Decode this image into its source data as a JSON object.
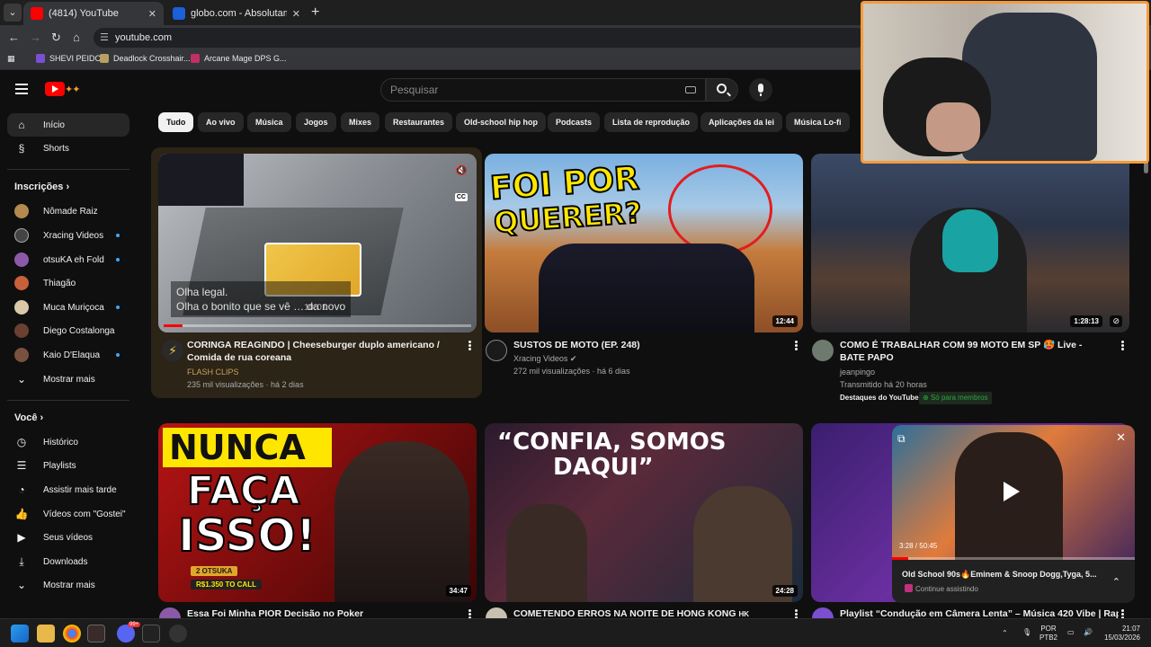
{
  "browser": {
    "tabs": [
      {
        "title": "(4814) YouTube",
        "active": true
      },
      {
        "title": "globo.com - Absolutamente tu",
        "active": false
      }
    ],
    "new_tab": "+",
    "url": "youtube.com",
    "bookmarks": [
      "SHEVI PEIDO",
      "Deadlock Crosshair...",
      "Arcane Mage DPS G..."
    ]
  },
  "youtube": {
    "search_placeholder": "Pesquisar",
    "sidebar": {
      "main": [
        {
          "label": "Início",
          "icon": "home-icon",
          "active": true
        },
        {
          "label": "Shorts",
          "icon": "shorts-icon",
          "active": false
        }
      ],
      "subscriptions_header": "Inscrições",
      "subscriptions": [
        {
          "label": "Nômade Raiz",
          "color": "#b58a4f",
          "dot": false
        },
        {
          "label": "Xracing Videos",
          "color": "#444444",
          "dot": true
        },
        {
          "label": "otsuKA eh Fold",
          "color": "#8a5aa8",
          "dot": true
        },
        {
          "label": "Thiagão",
          "color": "#c8603a",
          "dot": false
        },
        {
          "label": "Muca Muriçoca",
          "color": "#d9c9a8",
          "dot": true
        },
        {
          "label": "Diego Costalonga",
          "color": "#6a4030",
          "dot": false
        },
        {
          "label": "Kaio D'Elaqua",
          "color": "#7a5040",
          "dot": true
        }
      ],
      "show_more": "Mostrar mais",
      "you_header": "Você",
      "you": [
        {
          "label": "Histórico",
          "icon": "history-icon"
        },
        {
          "label": "Playlists",
          "icon": "playlists-icon"
        },
        {
          "label": "Assistir mais tarde",
          "icon": "watch-later-icon"
        },
        {
          "label": "Vídeos com \"Gostei\"",
          "icon": "like-icon"
        },
        {
          "label": "Seus vídeos",
          "icon": "your-videos-icon"
        },
        {
          "label": "Downloads",
          "icon": "downloads-icon"
        }
      ],
      "show_more_2": "Mostrar mais"
    },
    "chips": [
      "Tudo",
      "Ao vivo",
      "Música",
      "Jogos",
      "Mixes",
      "Restaurantes",
      "Old-school hip hop",
      "Podcasts",
      "Lista de reprodução",
      "Aplicações da lei",
      "Música Lo-fi"
    ],
    "videos": [
      {
        "title": "CORINGA REAGINDO | Cheeseburger duplo americano / Comida de rua coreana",
        "channel": "FLASH CLIPS",
        "meta": "235 mil visualizações · há 2 dias",
        "preview_caption_1": "Olha legal.",
        "preview_caption_2": "Olha o bonito que se vê … da novo",
        "preview_time": "10:01",
        "cc": "CC",
        "progress": 0.06
      },
      {
        "title": "SUSTOS DE MOTO (EP. 248)",
        "channel": "Xracing Videos",
        "meta": "272 mil visualizações · há 6 dias",
        "duration": "12:44",
        "thumb_text_1": "FOI POR",
        "thumb_text_2": "QUERER?"
      },
      {
        "title": "COMO É TRABALHAR COM 99 MOTO EM SP 🥵 Live - BATE PAPO",
        "channel": "jeanpingo",
        "meta": "Transmitido há 20 horas",
        "badge_1": "Destaques do YouTube",
        "badge_2": "Só para membros",
        "duration": "1:28:13"
      },
      {
        "title": "Essa Foi Minha PIOR Decisão no Poker",
        "duration": "34:47",
        "thumb_text_1": "NUNCA",
        "thumb_text_2": "FAÇA",
        "thumb_text_3": "ISSO!",
        "thumb_badge_1": "2 OTSUKA",
        "thumb_badge_2": "R$1.350 TO CALL"
      },
      {
        "title": "COMETENDO ERROS NA NOITE DE HONG KONG",
        "title_suffix": "HK",
        "duration": "24:28",
        "thumb_text_1": "“CONFIA, SOMOS",
        "thumb_text_2": "DAQUI”"
      },
      {
        "title": "Playlist “Condução em Câmera Lenta” – Música 420 Vibe | Rap"
      }
    ],
    "miniplayer": {
      "time": "3:28 / 50:45",
      "title": "Old School 90s🔥Eminem & Snoop Dogg,Tyga, 5...",
      "status": "Continue assistindo",
      "progress": 0.068
    }
  },
  "taskbar": {
    "lang_1": "POR",
    "lang_2": "PTB2",
    "time": "21:07",
    "date": "15/03/2026",
    "badge": "99+"
  }
}
